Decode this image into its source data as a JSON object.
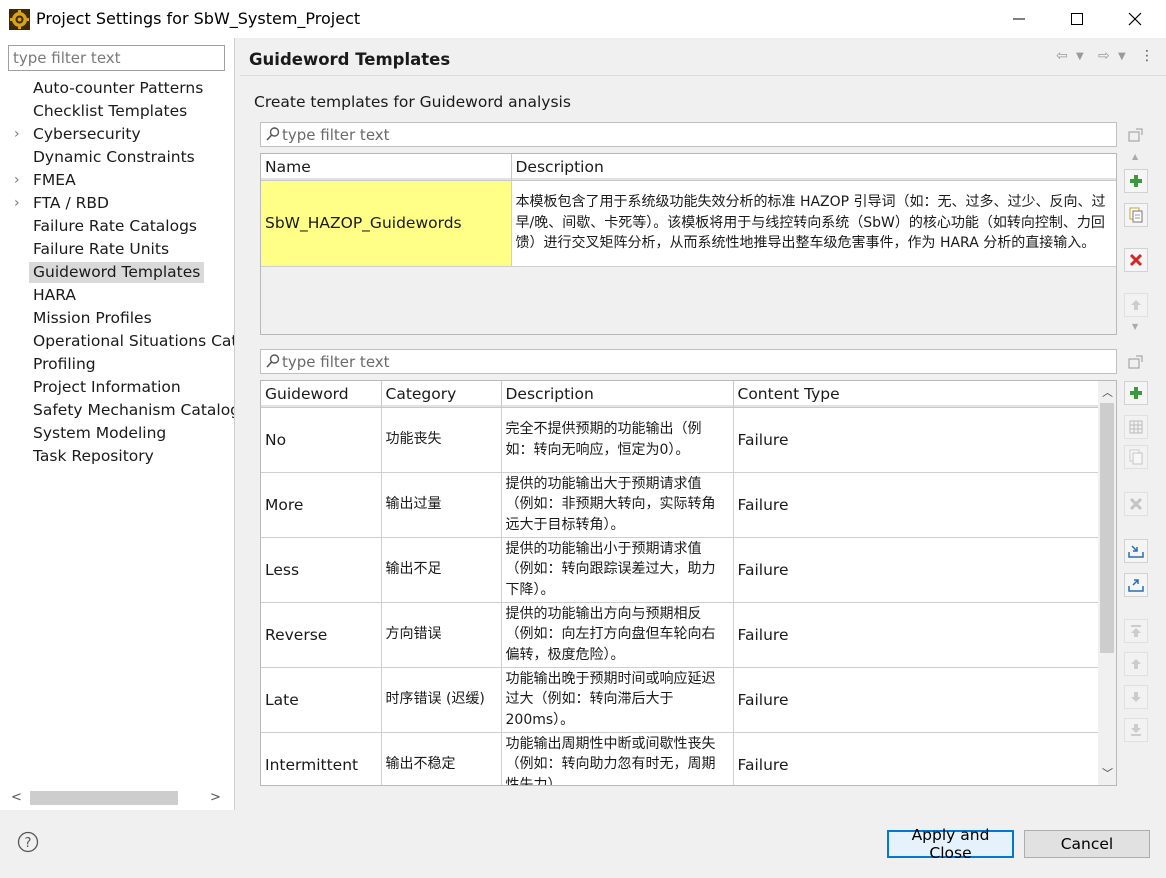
{
  "window": {
    "title": "Project Settings for SbW_System_Project",
    "app_icon": "gear-icon"
  },
  "sidebar": {
    "filter_placeholder": "type filter text",
    "items": [
      {
        "label": "Auto-counter Patterns",
        "expandable": false
      },
      {
        "label": "Checklist Templates",
        "expandable": false
      },
      {
        "label": "Cybersecurity",
        "expandable": true
      },
      {
        "label": "Dynamic Constraints",
        "expandable": false
      },
      {
        "label": "FMEA",
        "expandable": true
      },
      {
        "label": "FTA / RBD",
        "expandable": true
      },
      {
        "label": "Failure Rate Catalogs",
        "expandable": false
      },
      {
        "label": "Failure Rate Units",
        "expandable": false
      },
      {
        "label": "Guideword Templates",
        "expandable": false,
        "selected": true
      },
      {
        "label": "HARA",
        "expandable": false
      },
      {
        "label": "Mission Profiles",
        "expandable": false
      },
      {
        "label": "Operational Situations Cata",
        "expandable": false
      },
      {
        "label": "Profiling",
        "expandable": false
      },
      {
        "label": "Project Information",
        "expandable": false
      },
      {
        "label": "Safety Mechanism Catalog",
        "expandable": false
      },
      {
        "label": "System Modeling",
        "expandable": false
      },
      {
        "label": "Task Repository",
        "expandable": false
      }
    ]
  },
  "main": {
    "title": "Guideword Templates",
    "description": "Create templates for Guideword analysis",
    "templates": {
      "filter_placeholder": "type filter text",
      "columns": [
        "Name",
        "Description"
      ],
      "rows": [
        {
          "name": "SbW_HAZOP_Guidewords",
          "description": "本模板包含了用于系统级功能失效分析的标准 HAZOP 引导词（如：无、过多、过少、反向、过早/晚、间歇、卡死等）。该模板将用于与线控转向系统（SbW）的核心功能（如转向控制、力回馈）进行交叉矩阵分析，从而系统性地推导出整车级危害事件，作为 HARA 分析的直接输入。"
        }
      ]
    },
    "guidewords": {
      "filter_placeholder": "type filter text",
      "columns": [
        "Guideword",
        "Category",
        "Description",
        "Content Type"
      ],
      "rows": [
        {
          "guideword": "No",
          "category": "功能丧失",
          "description": "完全不提供预期的功能输出（例如：转向无响应，恒定为0）。",
          "content_type": "Failure"
        },
        {
          "guideword": "More",
          "category": "输出过量",
          "description": "提供的功能输出大于预期请求值（例如：非预期大转向，实际转角远大于目标转角）。",
          "content_type": "Failure"
        },
        {
          "guideword": "Less",
          "category": "输出不足",
          "description": "提供的功能输出小于预期请求值（例如：转向跟踪误差过大，助力下降）。",
          "content_type": "Failure"
        },
        {
          "guideword": "Reverse",
          "category": "方向错误",
          "description": "提供的功能输出方向与预期相反（例如：向左打方向盘但车轮向右偏转，极度危险）。",
          "content_type": "Failure"
        },
        {
          "guideword": "Late",
          "category": "时序错误 (迟缓)",
          "description": "功能输出晚于预期时间或响应延迟过大（例如：转向滞后大于200ms）。",
          "content_type": "Failure"
        },
        {
          "guideword": "Intermittent",
          "category": "输出不稳定",
          "description": "功能输出周期性中断或间歇性丧失（例如：转向助力忽有时无，周期性失力）。",
          "content_type": "Failure"
        }
      ]
    }
  },
  "footer": {
    "help_icon": "help-icon",
    "apply_label": "Apply and Close",
    "cancel_label": "Cancel"
  }
}
